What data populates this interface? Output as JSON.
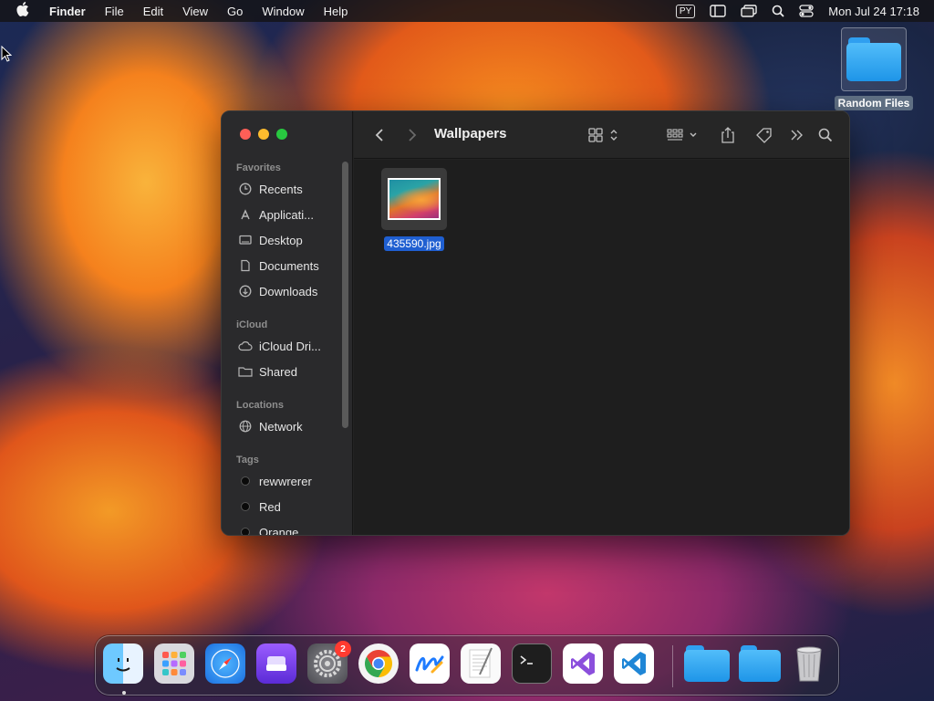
{
  "menubar": {
    "app_name": "Finder",
    "items": [
      "File",
      "Edit",
      "View",
      "Go",
      "Window",
      "Help"
    ],
    "input_source": "PY",
    "clock": "Mon Jul 24  17:18"
  },
  "desktop": {
    "icon_label": "Random Files"
  },
  "finder": {
    "title": "Wallpapers",
    "sidebar": {
      "favorites_label": "Favorites",
      "favorites": [
        "Recents",
        "Applicati...",
        "Desktop",
        "Documents",
        "Downloads"
      ],
      "icloud_label": "iCloud",
      "icloud": [
        "iCloud Dri...",
        "Shared"
      ],
      "locations_label": "Locations",
      "locations": [
        "Network"
      ],
      "tags_label": "Tags",
      "tags": [
        "rewwrerer",
        "Red",
        "Orange"
      ]
    },
    "files": [
      {
        "name": "435590.jpg"
      }
    ]
  },
  "dock": {
    "settings_badge": "2"
  }
}
